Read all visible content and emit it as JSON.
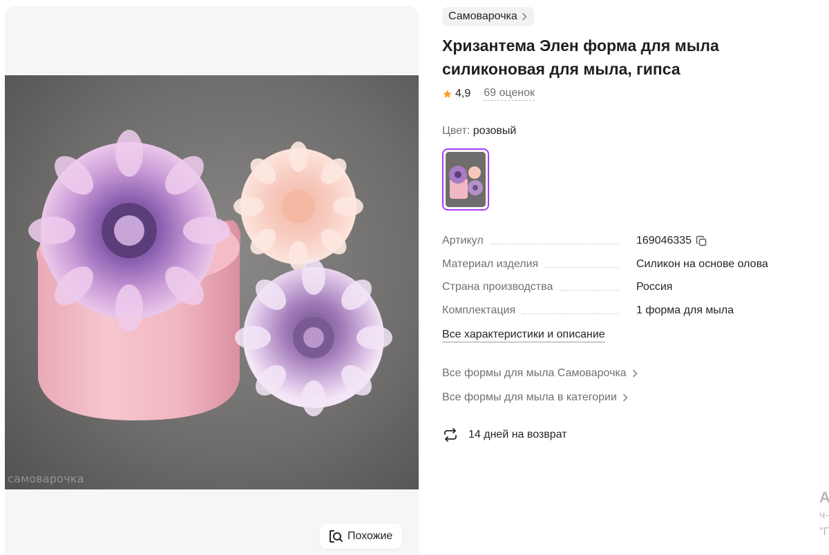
{
  "gallery": {
    "watermark": "самоварочка",
    "similar_label": "Похожие"
  },
  "product": {
    "brand": "Самоварочка",
    "title": "Хризантема Элен форма для мыла силиконовая для мыла, гипса",
    "rating": "4,9",
    "reviews": "69 оценок",
    "color_label": "Цвет:",
    "color_value": "розовый"
  },
  "specs": [
    {
      "key": "Артикул",
      "value": "169046335"
    },
    {
      "key": "Материал изделия",
      "value": "Силикон на основе олова"
    },
    {
      "key": "Страна производства",
      "value": "Россия"
    },
    {
      "key": "Комплектация",
      "value": "1 форма для мыла"
    }
  ],
  "links": {
    "all_specs": "Все характеристики и описание",
    "brand_forms": "Все формы для мыла Самоварочка",
    "category_forms": "Все формы для мыла в категории"
  },
  "returns": {
    "text": "14 дней на возврат"
  },
  "edge_cutoff": {
    "line1": "А",
    "line2": "ч-",
    "line3": "\"Г"
  },
  "colors": {
    "accent": "#a73afd",
    "star": "#ff9a2e",
    "muted_text": "#707070",
    "chip_bg": "#f2f2f5"
  }
}
